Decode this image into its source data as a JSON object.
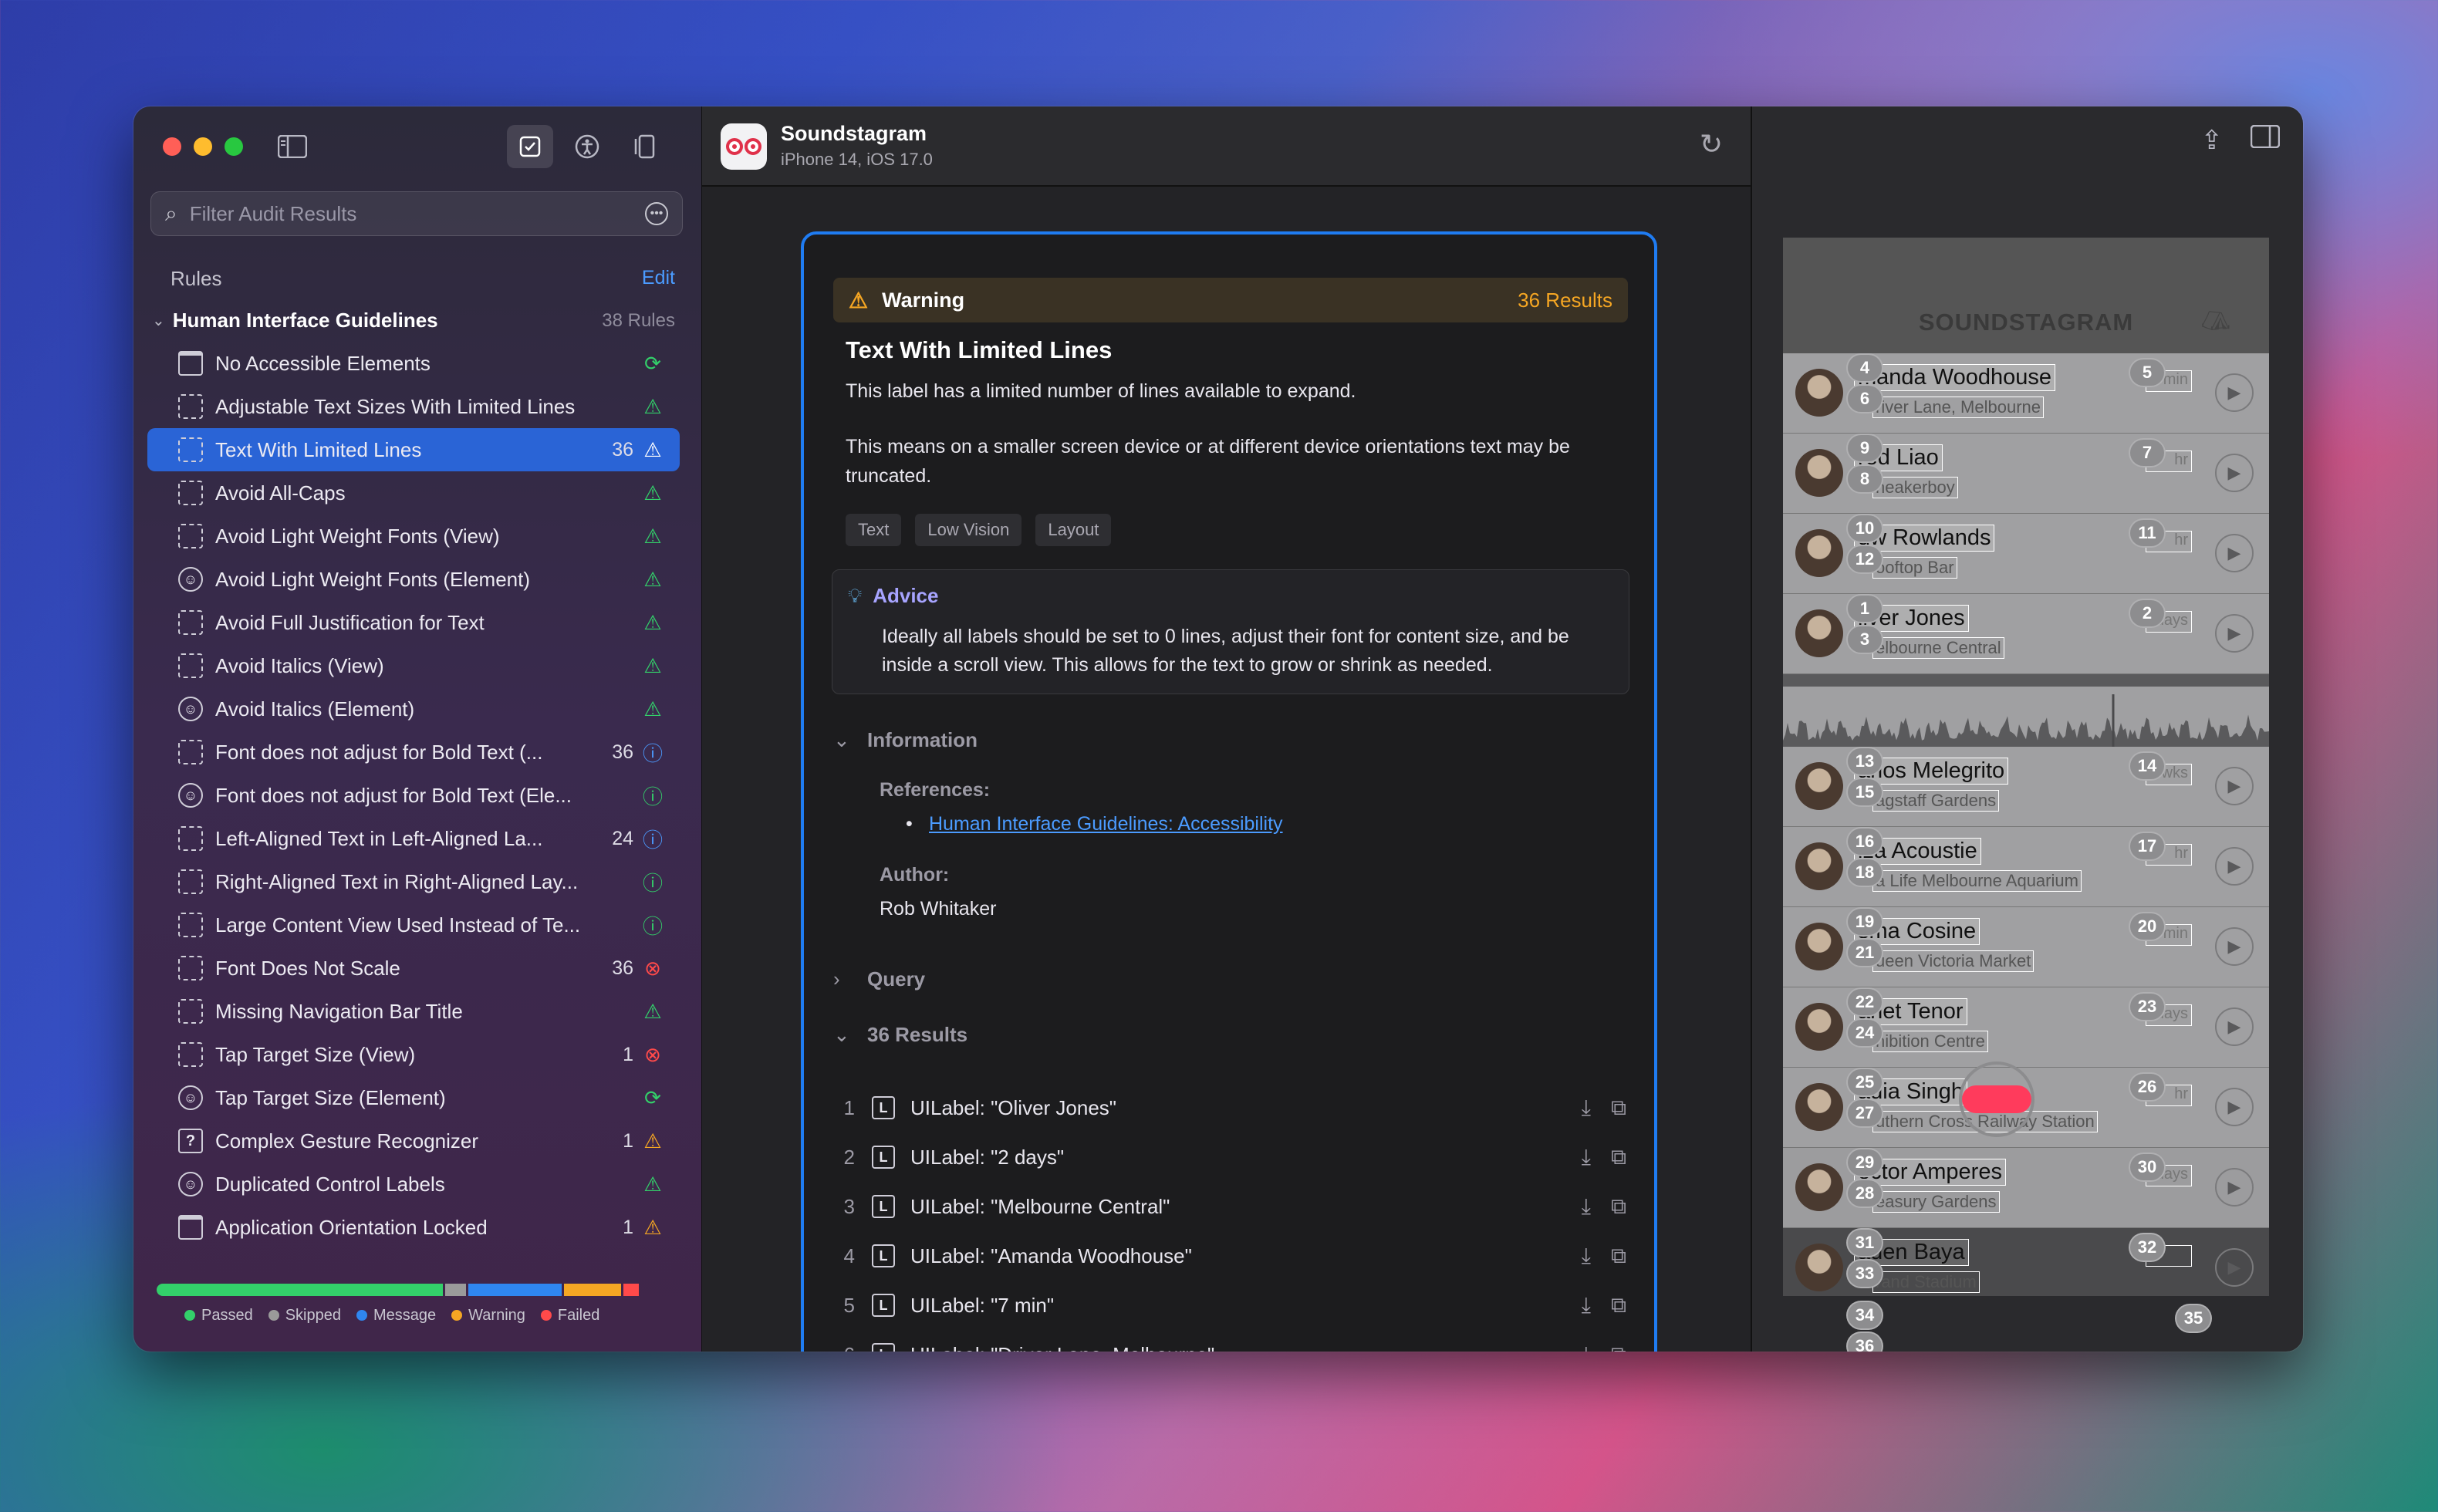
{
  "sidebar": {
    "search_placeholder": "Filter Audit Results",
    "rules_heading": "Rules",
    "edit_label": "Edit",
    "group": {
      "title": "Human Interface Guidelines",
      "count": "38 Rules"
    },
    "items": [
      {
        "label": "No Accessible Elements",
        "count": "",
        "icon": "window-icon",
        "status": "passed-skipped"
      },
      {
        "label": "Adjustable Text Sizes With Limited Lines",
        "count": "",
        "icon": "dashed-box-icon",
        "status": "passed"
      },
      {
        "label": "Text With Limited Lines",
        "count": "36",
        "icon": "dashed-box-icon",
        "status": "warning",
        "selected": true
      },
      {
        "label": "Avoid All-Caps",
        "count": "",
        "icon": "dashed-box-icon",
        "status": "passed"
      },
      {
        "label": "Avoid Light Weight Fonts (View)",
        "count": "",
        "icon": "dashed-box-icon",
        "status": "passed"
      },
      {
        "label": "Avoid Light Weight Fonts (Element)",
        "count": "",
        "icon": "accessibility-icon",
        "status": "passed"
      },
      {
        "label": "Avoid Full Justification for Text",
        "count": "",
        "icon": "dashed-box-icon",
        "status": "passed"
      },
      {
        "label": "Avoid Italics (View)",
        "count": "",
        "icon": "dashed-box-icon",
        "status": "passed"
      },
      {
        "label": "Avoid Italics (Element)",
        "count": "",
        "icon": "accessibility-icon",
        "status": "passed"
      },
      {
        "label": "Font does not adjust for Bold Text (...",
        "count": "36",
        "icon": "dashed-box-icon",
        "status": "message"
      },
      {
        "label": "Font does not adjust for Bold Text (Ele...",
        "count": "",
        "icon": "accessibility-icon",
        "status": "info-passed"
      },
      {
        "label": "Left-Aligned Text in Left-Aligned La...",
        "count": "24",
        "icon": "dashed-box-icon",
        "status": "message"
      },
      {
        "label": "Right-Aligned Text in Right-Aligned Lay...",
        "count": "",
        "icon": "dashed-box-icon",
        "status": "info-passed"
      },
      {
        "label": "Large Content View Used Instead of Te...",
        "count": "",
        "icon": "dashed-box-icon",
        "status": "info-passed"
      },
      {
        "label": "Font Does Not Scale",
        "count": "36",
        "icon": "dashed-box-icon",
        "status": "failed"
      },
      {
        "label": "Missing Navigation Bar Title",
        "count": "",
        "icon": "dashed-box-icon",
        "status": "passed"
      },
      {
        "label": "Tap Target Size (View)",
        "count": "1",
        "icon": "dashed-box-icon",
        "status": "failed"
      },
      {
        "label": "Tap Target Size (Element)",
        "count": "",
        "icon": "accessibility-icon",
        "status": "passed-skipped"
      },
      {
        "label": "Complex Gesture Recognizer",
        "count": "1",
        "icon": "question-box-icon",
        "status": "warning"
      },
      {
        "label": "Duplicated Control Labels",
        "count": "",
        "icon": "accessibility-icon",
        "status": "passed"
      },
      {
        "label": "Application Orientation Locked",
        "count": "1",
        "icon": "window-icon",
        "status": "warning"
      }
    ],
    "summary_bar": [
      {
        "key": "passed",
        "fraction": 0.55,
        "color": "#33d06a"
      },
      {
        "key": "skipped",
        "fraction": 0.04,
        "color": "#9a9a9a"
      },
      {
        "key": "message",
        "fraction": 0.18,
        "color": "#2f86f0"
      },
      {
        "key": "warning",
        "fraction": 0.11,
        "color": "#f5a623"
      },
      {
        "key": "failed",
        "fraction": 0.03,
        "color": "#ff4a4a"
      }
    ],
    "legend": [
      {
        "label": "Passed",
        "color": "#33d06a"
      },
      {
        "label": "Skipped",
        "color": "#9a9a9a"
      },
      {
        "label": "Message",
        "color": "#2f86f0"
      },
      {
        "label": "Warning",
        "color": "#f5a623"
      },
      {
        "label": "Failed",
        "color": "#ff4a4a"
      }
    ]
  },
  "header": {
    "app_name": "Soundstagram",
    "device": "iPhone 14, iOS 17.0"
  },
  "detail": {
    "severity": "Warning",
    "results_count": "36 Results",
    "title": "Text With Limited Lines",
    "para1": "This label has a limited number of lines available to expand.",
    "para2": "This means on a smaller screen device or at different device orientations text may be truncated.",
    "tags": [
      "Text",
      "Low Vision",
      "Layout"
    ],
    "advice_heading": "Advice",
    "advice_text": "Ideally all labels should be set to 0 lines, adjust their font for content size, and be inside a scroll view. This allows for the text to grow or shrink as needed.",
    "information_heading": "Information",
    "references_label": "References:",
    "reference_link": "Human Interface Guidelines: Accessibility",
    "author_label": "Author:",
    "author": "Rob Whitaker",
    "query_heading": "Query",
    "results_heading": "36 Results",
    "results": [
      {
        "n": "1",
        "text": "UILabel: \"Oliver Jones\""
      },
      {
        "n": "2",
        "text": "UILabel: \"2 days\""
      },
      {
        "n": "3",
        "text": "UILabel: \"Melbourne Central\""
      },
      {
        "n": "4",
        "text": "UILabel: \"Amanda Woodhouse\""
      },
      {
        "n": "5",
        "text": "UILabel: \"7 min\""
      },
      {
        "n": "6",
        "text": "UILabel: \"Driver Lane, Melbourne\""
      }
    ]
  },
  "preview": {
    "logo": "SOUNDSTAGRAM",
    "rows": [
      {
        "name": "manda Woodhouse",
        "place": "river Lane, Melbourne",
        "time": "min",
        "b1": "4",
        "b2": "6",
        "b3": "5"
      },
      {
        "name": "red Liao",
        "place": "neakerboy",
        "time": "hr",
        "b1": "9",
        "b2": "8",
        "b3": "7"
      },
      {
        "name": "uw Rowlands",
        "place": "ooftop Bar",
        "time": "hr",
        "b1": "10",
        "b2": "12",
        "b3": "11"
      },
      {
        "name": "liver Jones",
        "place": "elbourne Central",
        "time": "days",
        "b1": "1",
        "b2": "3",
        "b3": "2"
      },
      {
        "name": "arlos Melegrito",
        "place": "agstaff Gardens",
        "time": "wks",
        "b1": "13",
        "b2": "15",
        "b3": "14"
      },
      {
        "name": "iza Acoustie",
        "place": "a Life Melbourne Aquarium",
        "time": "hr",
        "b1": "16",
        "b2": "18",
        "b3": "17"
      },
      {
        "name": "sma Cosine",
        "place": "ueen Victoria Market",
        "time": "min",
        "b1": "19",
        "b2": "21",
        "b3": "20"
      },
      {
        "name": "anet Tenor",
        "place": "hibition Centre",
        "time": "days",
        "b1": "22",
        "b2": "24",
        "b3": "23"
      },
      {
        "name": "adia Singh",
        "place": "uthern Cross Railway Station",
        "time": "hr",
        "b1": "25",
        "b2": "27",
        "b3": "26"
      },
      {
        "name": "ector Amperes",
        "place": "easury Gardens",
        "time": "days",
        "b1": "29",
        "b2": "28",
        "b3": "30"
      },
      {
        "name": "aden Baya",
        "place": "rand Stadium",
        "time": "",
        "b1": "31",
        "b2": "33",
        "b3": "32"
      }
    ],
    "extra_bubbles": [
      "34",
      "36",
      "35"
    ]
  }
}
